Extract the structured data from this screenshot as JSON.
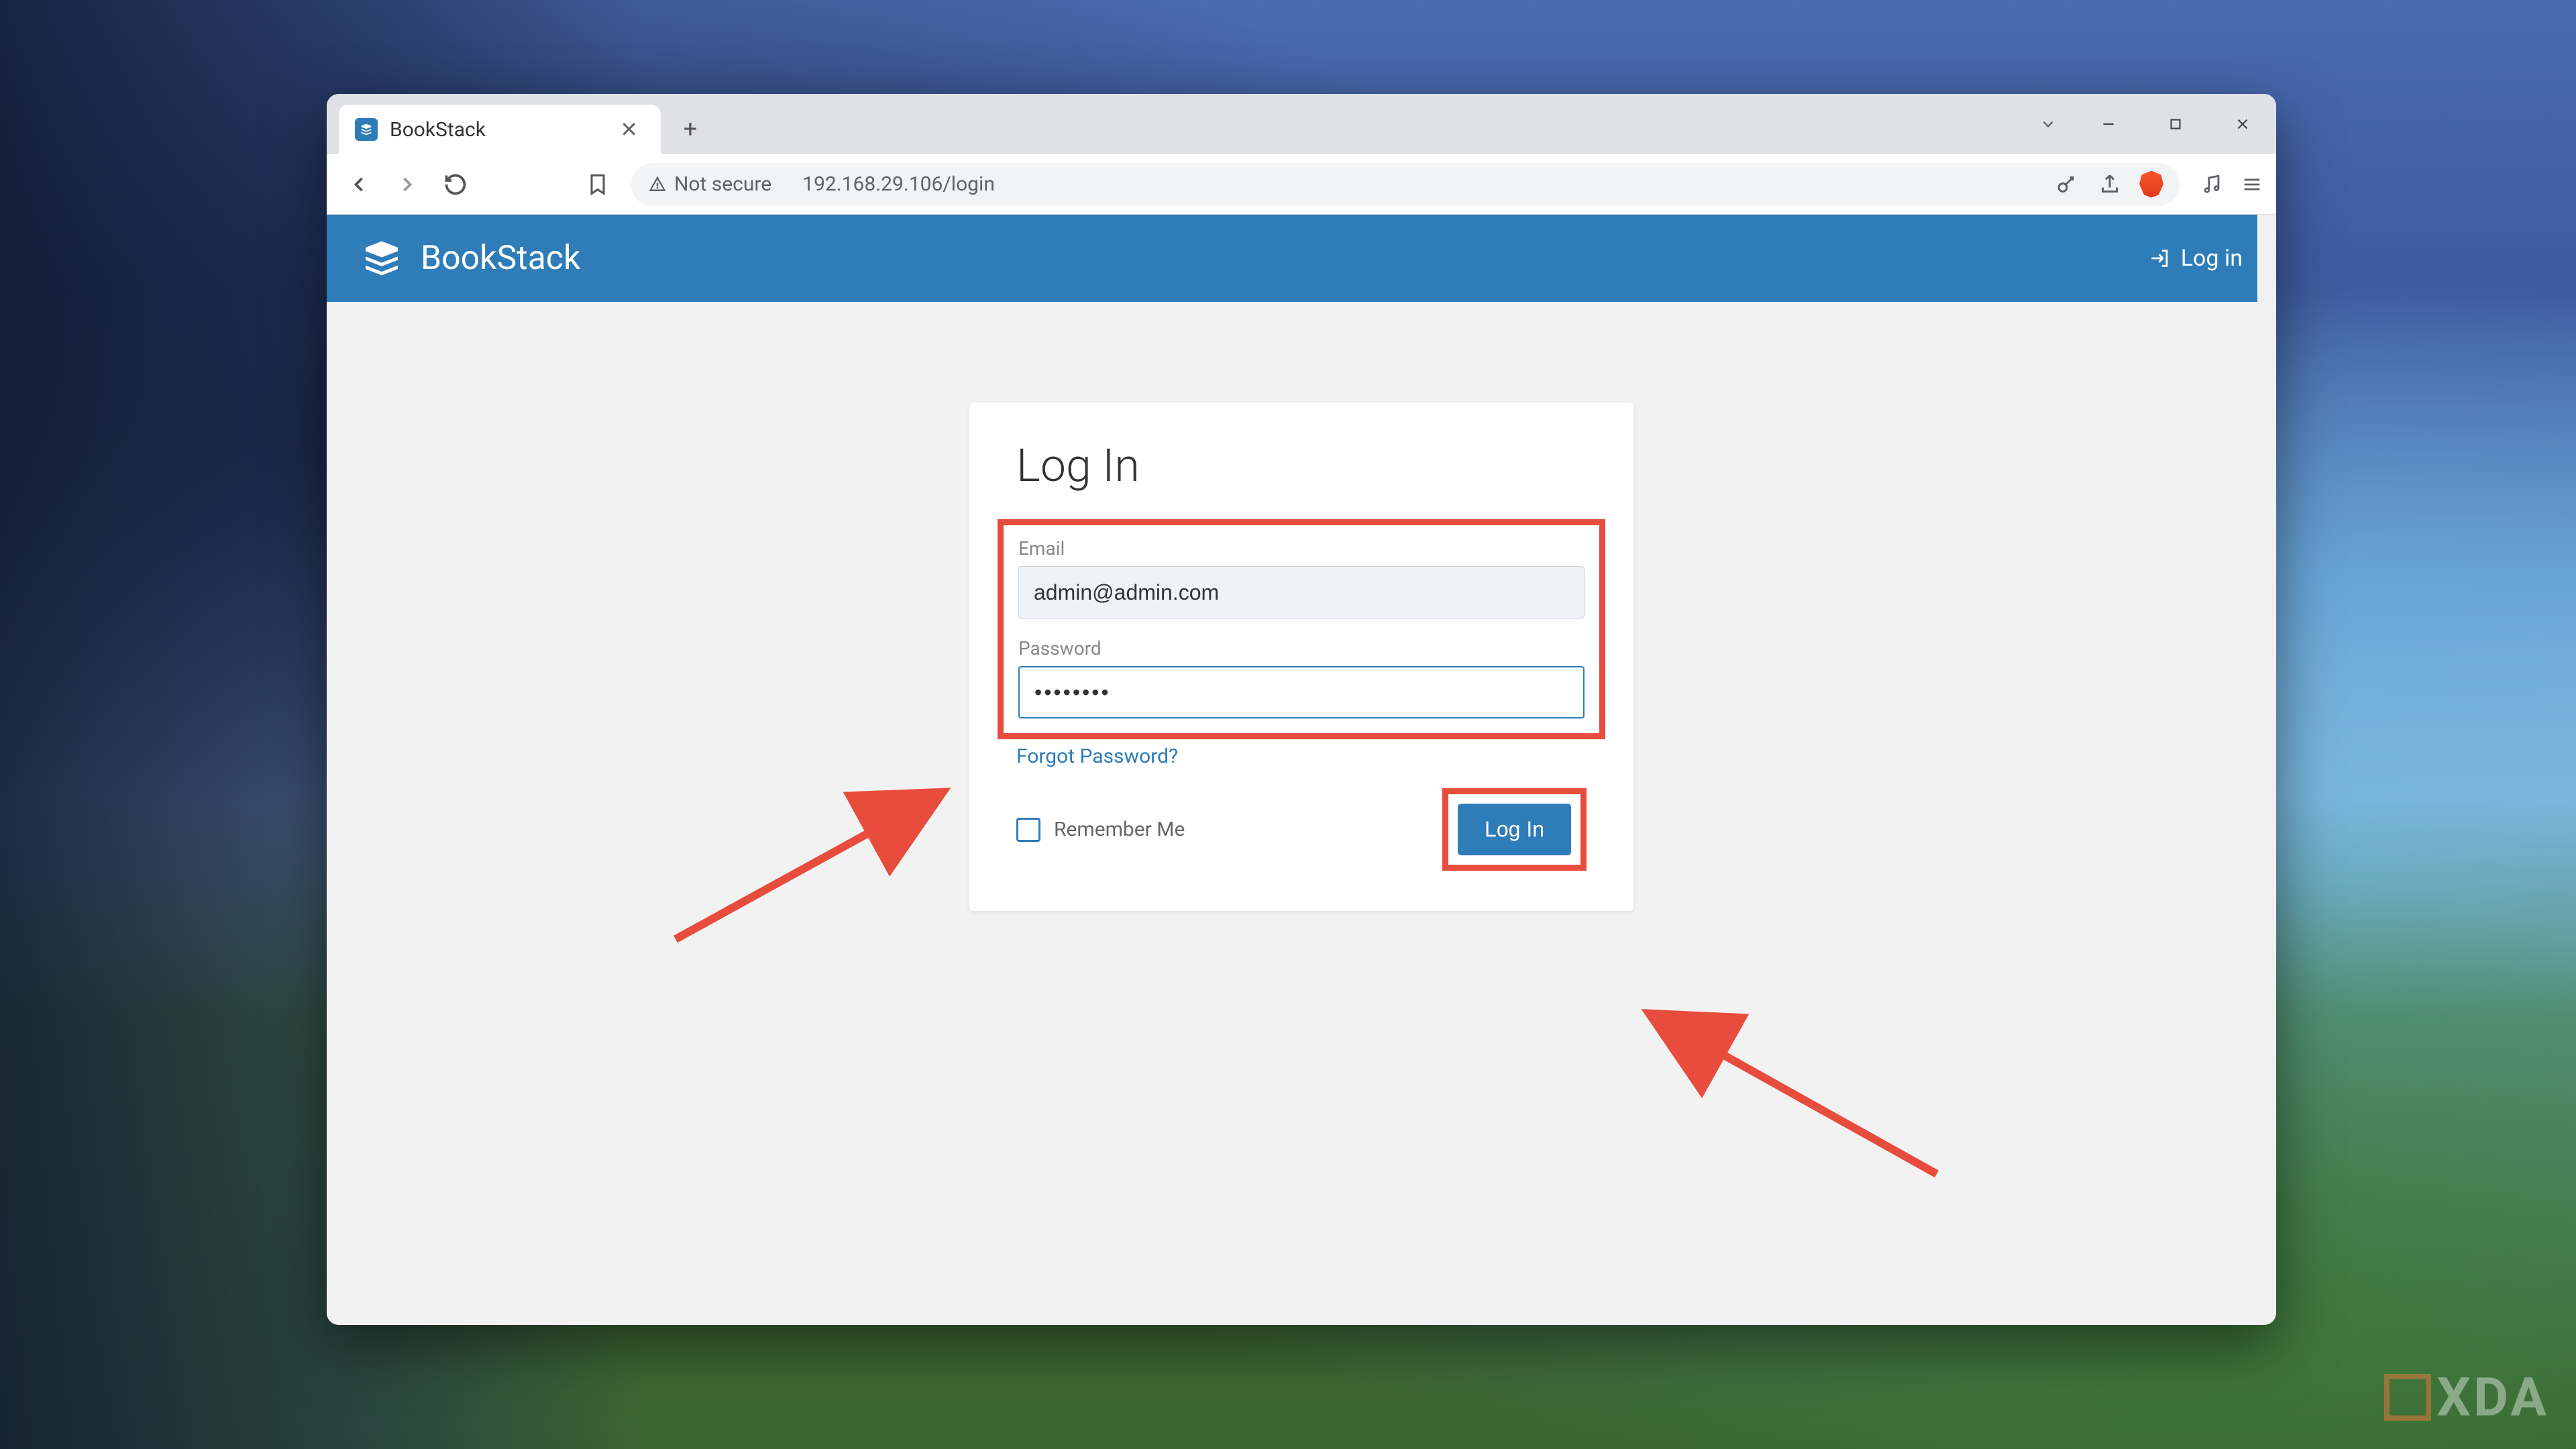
{
  "browser": {
    "tab_title": "BookStack",
    "security_label": "Not secure",
    "url": "192.168.29.106/login"
  },
  "app": {
    "brand": "BookStack",
    "header_login_label": "Log in"
  },
  "login": {
    "title": "Log In",
    "email_label": "Email",
    "email_value": "admin@admin.com",
    "password_label": "Password",
    "password_value": "••••••••",
    "forgot_label": "Forgot Password?",
    "remember_label": "Remember Me",
    "submit_label": "Log In"
  },
  "watermark": {
    "text": "XDA"
  }
}
